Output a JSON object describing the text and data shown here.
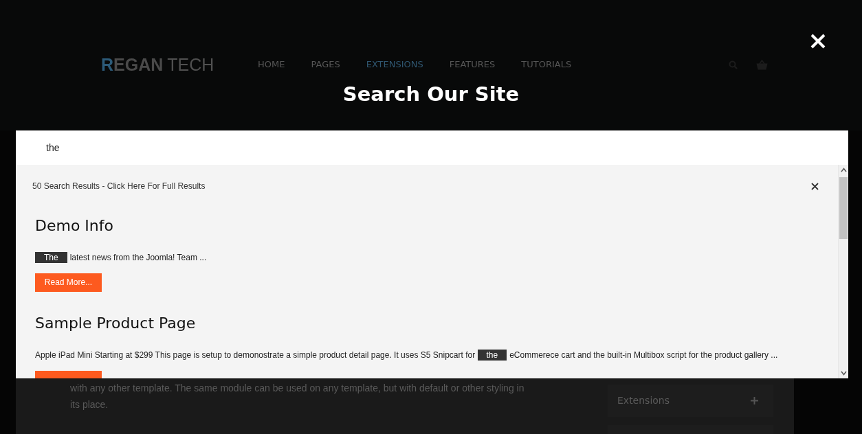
{
  "header": {
    "logo": {
      "accent": "R",
      "bold": "EGAN",
      "light": "TECH"
    },
    "nav": [
      {
        "label": "HOME",
        "selected": false
      },
      {
        "label": "PAGES",
        "selected": false
      },
      {
        "label": "EXTENSIONS",
        "selected": true
      },
      {
        "label": "FEATURES",
        "selected": false
      },
      {
        "label": "TUTORIALS",
        "selected": false
      }
    ]
  },
  "page": {
    "paragraphs": [
      "with any other template. The same module can be used on any template, but with default or other styling in\nits place."
    ],
    "sidebar": [
      {
        "label": "Extensions",
        "expanded": false
      }
    ]
  },
  "search": {
    "title": "Search Our Site",
    "value": "the"
  },
  "results": {
    "summary": "50 Search Results - Click Here For Full Results",
    "items": [
      {
        "title": "Demo Info",
        "snippet": [
          {
            "kind": "match",
            "text": "The"
          },
          {
            "kind": "text",
            "text": "latest news from the Joomla! Team  ..."
          }
        ],
        "has_button": true,
        "button": "Read More..."
      },
      {
        "title": "Sample Product Page",
        "snippet": [
          {
            "kind": "text",
            "text": "Apple iPad Mini Starting at $299 This page is setup to demonostrate a simple product detail page. It uses S5 Snipcart for"
          },
          {
            "kind": "match",
            "text": "the"
          },
          {
            "kind": "text",
            "text": "eCommerece cart and the built-in Multibox script for the product gallery ..."
          }
        ],
        "has_button": true
      }
    ]
  }
}
